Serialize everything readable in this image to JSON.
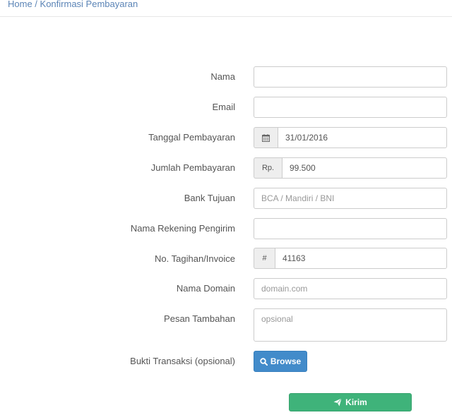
{
  "breadcrumb": {
    "home": "Home",
    "separator": " / ",
    "current": "Konfirmasi Pembayaran"
  },
  "form": {
    "nama": {
      "label": "Nama",
      "value": "",
      "placeholder": ""
    },
    "email": {
      "label": "Email",
      "value": "",
      "placeholder": ""
    },
    "tanggal": {
      "label": "Tanggal Pembayaran",
      "icon": "calendar-icon",
      "value": "31/01/2016"
    },
    "jumlah": {
      "label": "Jumlah Pembayaran",
      "prefix": "Rp.",
      "value": "99.500"
    },
    "bank": {
      "label": "Bank Tujuan",
      "value": "",
      "placeholder": "BCA / Mandiri / BNI"
    },
    "rekening": {
      "label": "Nama Rekening Pengirim",
      "value": "",
      "placeholder": ""
    },
    "invoice": {
      "label": "No. Tagihan/Invoice",
      "prefix": "#",
      "value": "41163"
    },
    "domain": {
      "label": "Nama Domain",
      "value": "",
      "placeholder": "domain.com"
    },
    "pesan": {
      "label": "Pesan Tambahan",
      "value": "",
      "placeholder": "opsional"
    },
    "bukti": {
      "label": "Bukti Transaksi (opsional)",
      "button_label": "Browse",
      "icon": "search-icon"
    }
  },
  "submit": {
    "label": "Kirim",
    "icon": "paper-plane-icon"
  },
  "colors": {
    "browse": "#428bca",
    "submit": "#3fb37a",
    "link": "#5b84b6"
  }
}
